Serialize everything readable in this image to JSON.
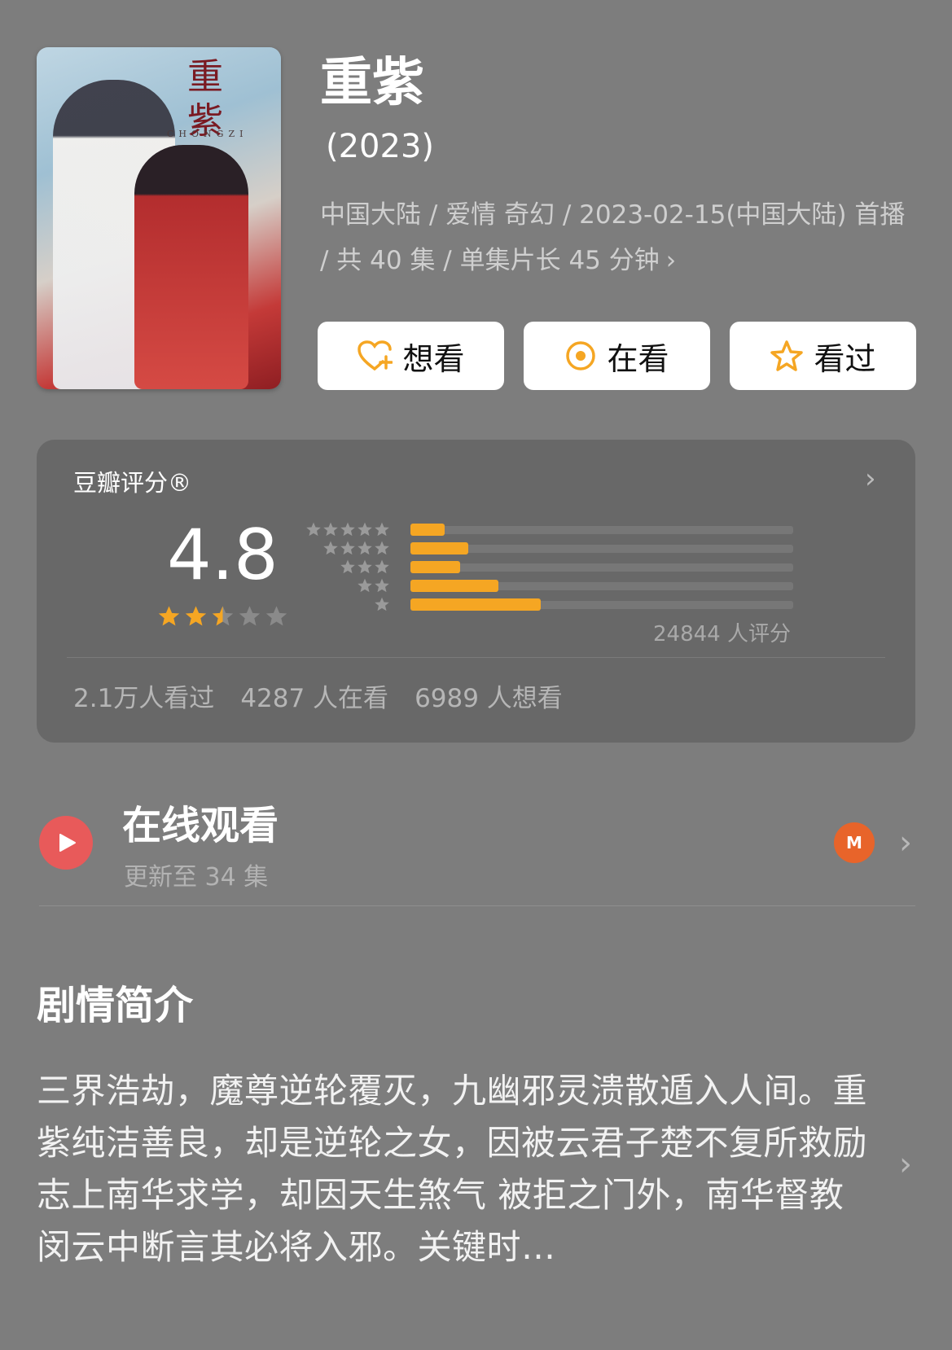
{
  "header": {
    "title": "重紫",
    "year": "(2023)",
    "meta": "中国大陆 / 爱情 奇幻 / 2023-02-15(中国大陆) 首播 / 共 40 集 / 单集片长 45 分钟",
    "meta_chevron": "›",
    "poster": {
      "title_text": "重紫",
      "pinyin": "CHONGZI"
    }
  },
  "actions": [
    {
      "label": "想看",
      "icon": "heart-plus-icon"
    },
    {
      "label": "在看",
      "icon": "target-circle-icon"
    },
    {
      "label": "看过",
      "icon": "star-outline-icon"
    }
  ],
  "rating": {
    "title": "豆瓣评分®",
    "score": "4.8",
    "stars_value": 2.5,
    "stars_max": 5,
    "count_text": "24844 人评分",
    "distribution": [
      {
        "stars": 5,
        "share": 0.09
      },
      {
        "stars": 4,
        "share": 0.15
      },
      {
        "stars": 3,
        "share": 0.13
      },
      {
        "stars": 2,
        "share": 0.23
      },
      {
        "stars": 1,
        "share": 0.34
      }
    ],
    "stats": [
      "2.1万人看过",
      "4287 人在看",
      "6989 人想看"
    ],
    "chevron": "›",
    "colors": {
      "accent": "#f5a623",
      "star_empty": "#8a8a8a"
    }
  },
  "online": {
    "title": "在线观看",
    "subtitle": "更新至 34 集",
    "provider_icon": "mgtv-logo-icon",
    "provider_text": "M",
    "chevron": "›",
    "colors": {
      "play": "#e85a5a",
      "provider": "#e8642a"
    }
  },
  "synopsis": {
    "title": "剧情简介",
    "text": "三界浩劫，魔尊逆轮覆灭，九幽邪灵溃散遁入人间。重紫纯洁善良，却是逆轮之女，因被云君子楚不复所救励志上南华求学，却因天生煞气 被拒之门外，南华督教闵云中断言其必将入邪。关键时…",
    "chevron": "›"
  }
}
